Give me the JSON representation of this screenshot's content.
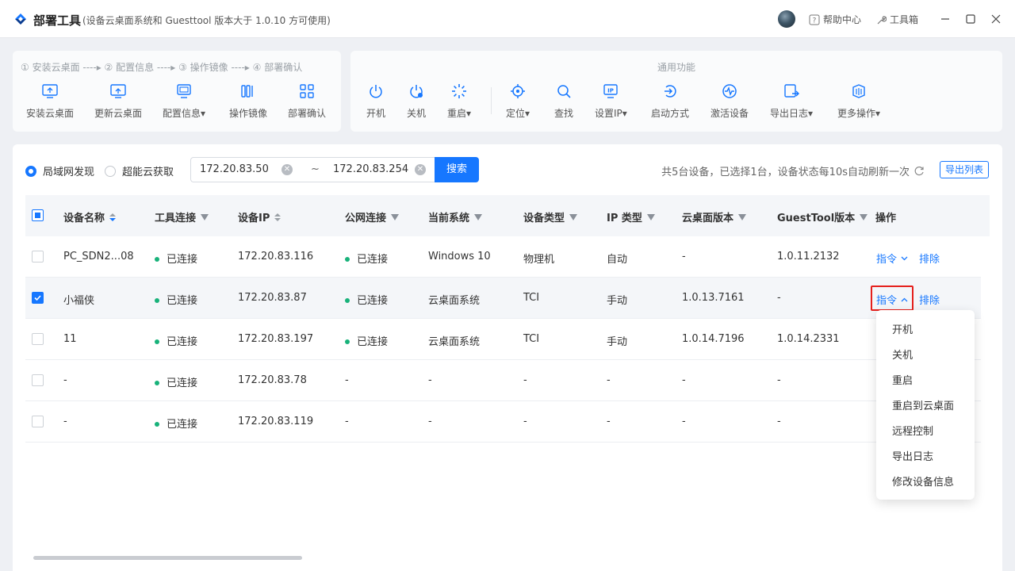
{
  "app": {
    "title": "部署工具",
    "subtitle": "(设备云桌面系统和 Guesttool 版本大于 1.0.10 方可使用)",
    "help": "帮助中心",
    "toolbox": "工具箱"
  },
  "deploy": {
    "steps": "① 安装云桌面 ----▸ ② 配置信息 ----▸ ③ 操作镜像 ----▸ ④ 部署确认",
    "tools": [
      {
        "label": "安装云桌面",
        "icon": "install-desktop-icon"
      },
      {
        "label": "更新云桌面",
        "icon": "update-desktop-icon"
      },
      {
        "label": "配置信息▾",
        "icon": "config-icon"
      },
      {
        "label": "操作镜像",
        "icon": "image-icon"
      },
      {
        "label": "部署确认",
        "icon": "deploy-confirm-icon"
      }
    ]
  },
  "common": {
    "title": "通用功能",
    "tools": [
      {
        "label": "开机",
        "icon": "power-on-icon"
      },
      {
        "label": "关机",
        "icon": "power-off-icon"
      },
      {
        "label": "重启▾",
        "icon": "restart-icon"
      },
      {
        "label": "定位▾",
        "icon": "locate-icon"
      },
      {
        "label": "查找",
        "icon": "search-icon"
      },
      {
        "label": "设置IP▾",
        "icon": "set-ip-icon"
      },
      {
        "label": "启动方式",
        "icon": "boot-mode-icon"
      },
      {
        "label": "激活设备",
        "icon": "activate-icon"
      },
      {
        "label": "导出日志▾",
        "icon": "export-log-icon"
      },
      {
        "label": "更多操作▾",
        "icon": "more-actions-icon"
      }
    ]
  },
  "filter": {
    "radio_lan": "局域网发现",
    "radio_cloud": "超能云获取",
    "ip_start": "172.20.83.50",
    "ip_end": "172.20.83.254",
    "tilde": "~",
    "search": "搜索",
    "summary": "共5台设备，已选择1台，设备状态每10s自动刷新一次",
    "export": "导出列表"
  },
  "table": {
    "headers": [
      "设备名称",
      "工具连接",
      "设备IP",
      "公网连接",
      "当前系统",
      "设备类型",
      "IP 类型",
      "云桌面版本",
      "GuestTool版本",
      "操作"
    ],
    "rows": [
      {
        "name": "PC_SDN2...08",
        "tool": "已连接",
        "ip": "172.20.83.116",
        "wan": "已连接",
        "os": "Windows 10",
        "type": "物理机",
        "iptype": "自动",
        "cdver": "-",
        "gtver": "1.0.11.2132",
        "checked": false
      },
      {
        "name": "小福侠",
        "tool": "已连接",
        "ip": "172.20.83.87",
        "wan": "已连接",
        "os": "云桌面系统",
        "type": "TCI",
        "iptype": "手动",
        "cdver": "1.0.13.7161",
        "gtver": "-",
        "checked": true
      },
      {
        "name": "11",
        "tool": "已连接",
        "ip": "172.20.83.197",
        "wan": "已连接",
        "os": "云桌面系统",
        "type": "TCI",
        "iptype": "手动",
        "cdver": "1.0.14.7196",
        "gtver": "1.0.14.2331",
        "checked": false
      },
      {
        "name": "-",
        "tool": "已连接",
        "ip": "172.20.83.78",
        "wan": "-",
        "os": "-",
        "type": "-",
        "iptype": "-",
        "cdver": "-",
        "gtver": "-",
        "checked": false
      },
      {
        "name": "-",
        "tool": "已连接",
        "ip": "172.20.83.119",
        "wan": "-",
        "os": "-",
        "type": "-",
        "iptype": "-",
        "cdver": "-",
        "gtver": "-",
        "checked": false
      }
    ],
    "cmd": "指令",
    "del": "排除"
  },
  "menu": [
    "开机",
    "关机",
    "重启",
    "重启到云桌面",
    "远程控制",
    "导出日志",
    "修改设备信息"
  ],
  "colors": {
    "accent": "#1677ff",
    "connected": "#18b27a",
    "highlight": "#e5201c"
  }
}
